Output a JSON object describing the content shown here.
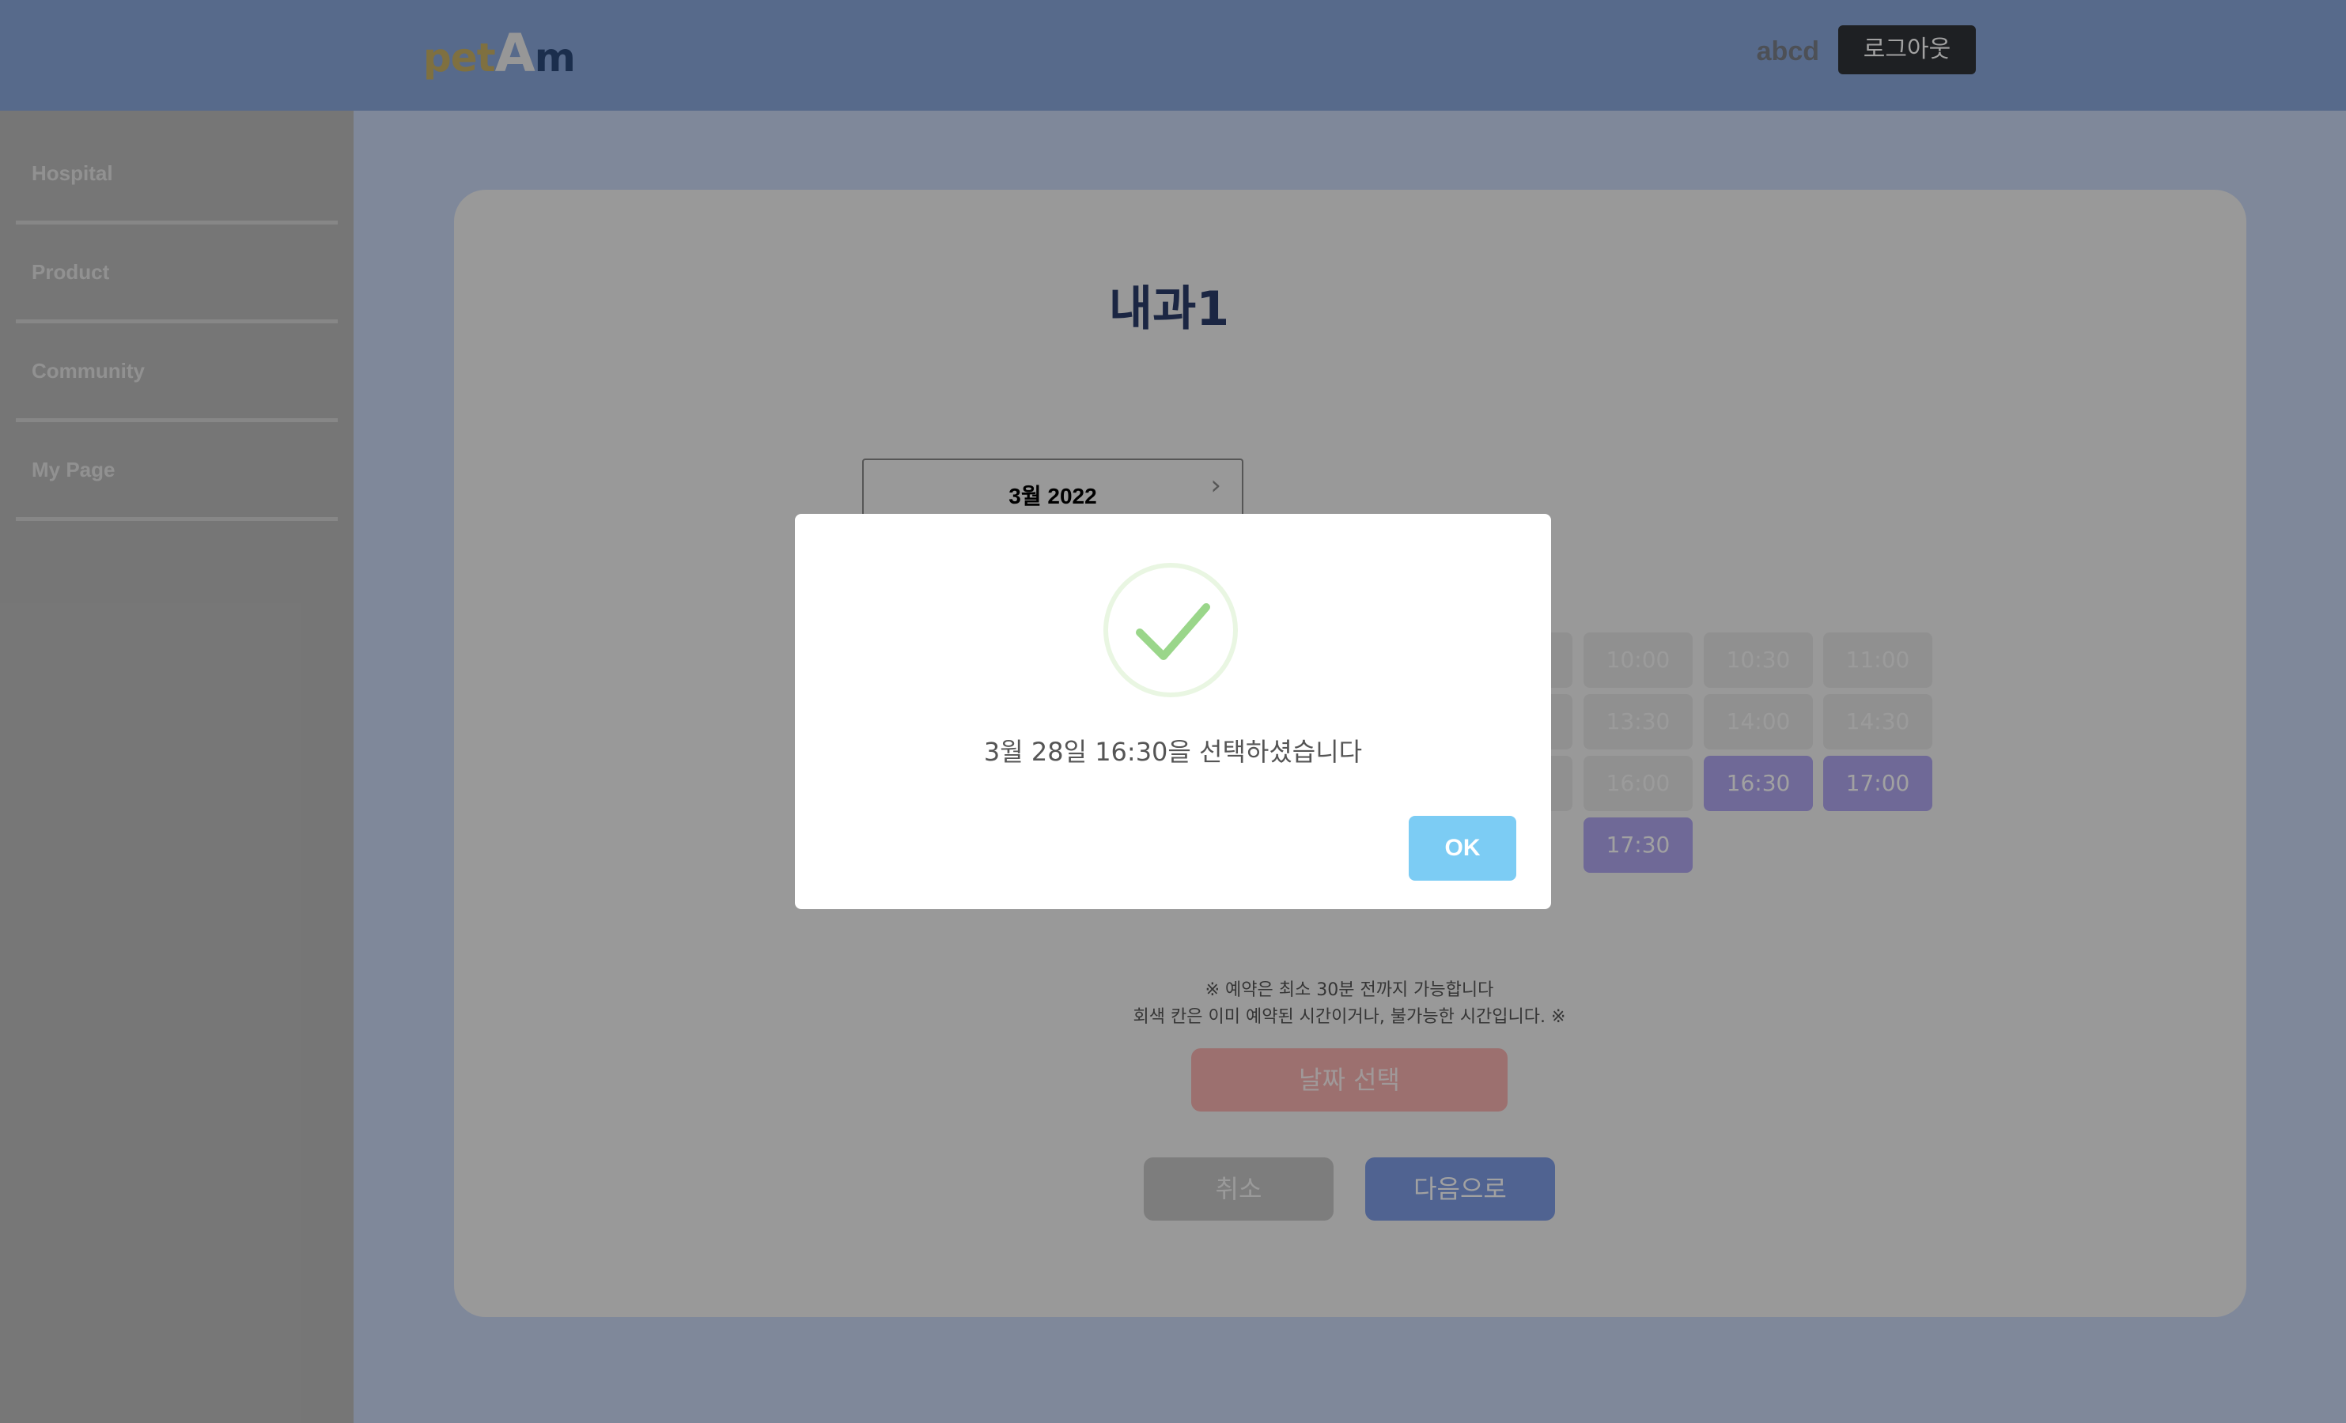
{
  "header": {
    "logo": {
      "part1": "pet",
      "part2": "A",
      "part3": "m"
    },
    "username": "abcd",
    "logout_label": "로그아웃"
  },
  "sidebar": {
    "items": [
      {
        "label": "Hospital"
      },
      {
        "label": "Product"
      },
      {
        "label": "Community"
      },
      {
        "label": "My Page"
      }
    ]
  },
  "main": {
    "title": "내과1",
    "calendar": {
      "month_label": "3월 2022"
    },
    "time_slots": [
      {
        "time": "10:00",
        "available": false
      },
      {
        "time": "10:30",
        "available": false
      },
      {
        "time": "11:00",
        "available": false
      },
      {
        "time": "13:30",
        "available": false
      },
      {
        "time": "14:00",
        "available": false
      },
      {
        "time": "14:30",
        "available": false
      },
      {
        "time": "16:00",
        "available": false
      },
      {
        "time": "16:30",
        "available": true
      },
      {
        "time": "17:00",
        "available": true
      },
      {
        "time": "17:30",
        "available": true
      }
    ],
    "note_line1": "※ 예약은 최소 30분 전까지 가능합니다",
    "note_line2": "회색 칸은 이미 예약된 시간이거나, 불가능한 시간입니다. ※",
    "select_date_label": "날짜 선택",
    "cancel_label": "취소",
    "next_label": "다음으로"
  },
  "modal": {
    "message": "3월 28일 16:30을 선택하셨습니다",
    "ok_label": "OK",
    "icon": "check-icon"
  },
  "colors": {
    "header_bg": "#8aa8dc",
    "sidebar_bg": "#bcbcbc",
    "available_slot": "#b0a6f0",
    "ok_button": "#7cccf4",
    "next_button": "#7f9de6",
    "date_button": "#f8b2b0"
  }
}
